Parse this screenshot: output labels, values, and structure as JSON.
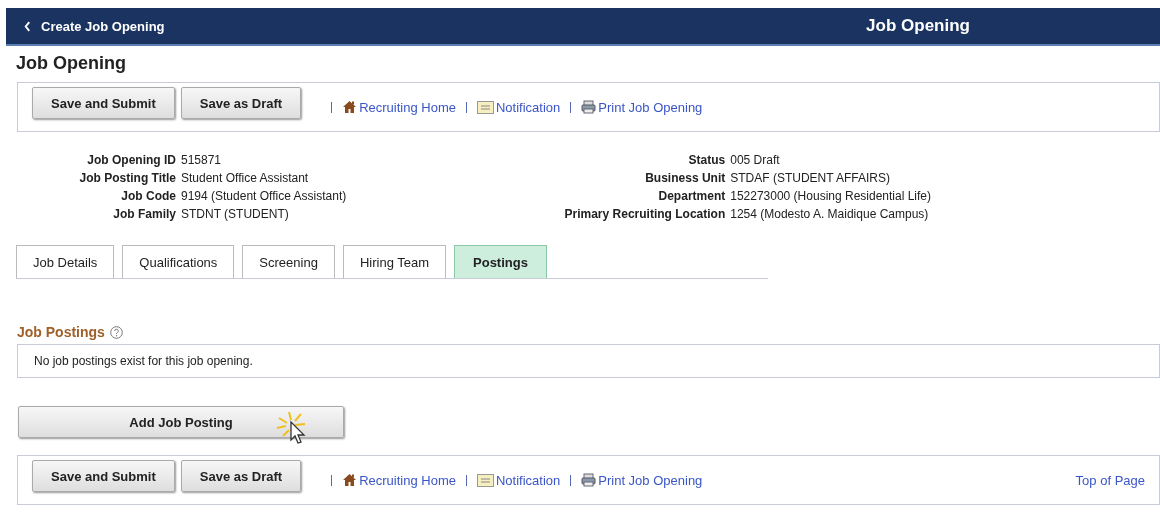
{
  "header": {
    "back_label": "Create Job Opening",
    "title": "Job Opening"
  },
  "page_title": "Job Opening",
  "top_toolbar": {
    "buttons": [
      "Save and Submit",
      "Save as Draft"
    ],
    "links": [
      {
        "kind": "home",
        "label": "Recruiting Home"
      },
      {
        "kind": "notification",
        "label": "Notification"
      },
      {
        "kind": "print",
        "label": "Print Job Opening"
      }
    ]
  },
  "fields_left": [
    {
      "label": "Job Opening ID",
      "value": "515871"
    },
    {
      "label": "Job Posting Title",
      "value": "Student Office Assistant"
    },
    {
      "label": "Job Code",
      "value": "9194 (Student Office Assistant)"
    },
    {
      "label": "Job Family",
      "value": "STDNT (STUDENT)"
    }
  ],
  "fields_right": [
    {
      "label": "Status",
      "value": "005 Draft"
    },
    {
      "label": "Business Unit",
      "value": "STDAF (STUDENT AFFAIRS)"
    },
    {
      "label": "Department",
      "value": "152273000 (Housing Residential Life)"
    },
    {
      "label": "Primary Recruiting Location",
      "value": "1254 (Modesto A. Maidique Campus)"
    }
  ],
  "tabs": [
    {
      "label": "Job Details",
      "selected": false
    },
    {
      "label": "Qualifications",
      "selected": false
    },
    {
      "label": "Screening",
      "selected": false
    },
    {
      "label": "Hiring Team",
      "selected": false
    },
    {
      "label": "Postings",
      "selected": true
    }
  ],
  "job_postings": {
    "title": "Job Postings",
    "empty_message": "No job postings exist for this job opening.",
    "add_button": "Add Job Posting"
  },
  "bottom_toolbar": {
    "buttons": [
      "Save and Submit",
      "Save as Draft"
    ],
    "links": [
      {
        "kind": "home",
        "label": "Recruiting Home"
      },
      {
        "kind": "notification",
        "label": "Notification"
      },
      {
        "kind": "print",
        "label": "Print Job Opening"
      }
    ],
    "top_link": "Top of Page"
  }
}
